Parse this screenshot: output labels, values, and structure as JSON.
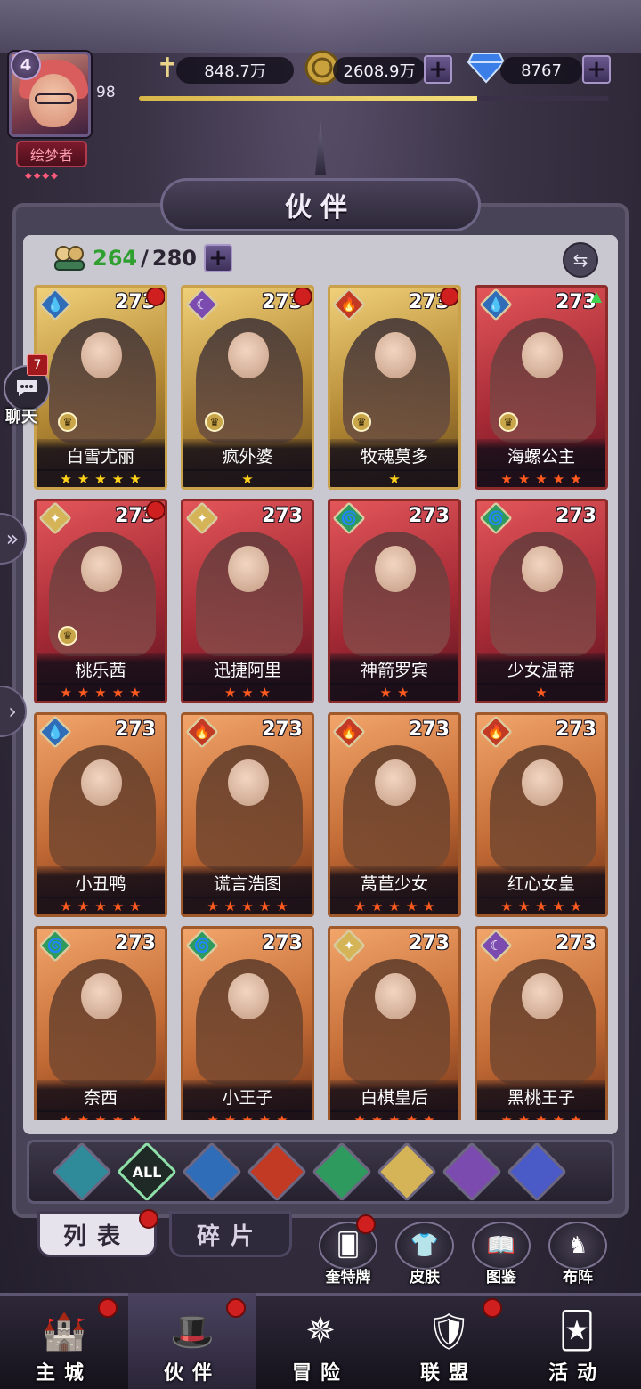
{
  "player": {
    "level": "4",
    "vip_value": "98",
    "title": "绘梦者",
    "title_stars": "◆◆◆◆"
  },
  "resources": {
    "power": "848.7万",
    "gold": "2608.9万",
    "diamonds": "8767",
    "plus": "+",
    "exp_progress": 0.72
  },
  "panel": {
    "title": "伙伴",
    "owned": "264",
    "separator": "/",
    "capacity": "280",
    "plus": "+",
    "sort_glyph": "⇆"
  },
  "chat": {
    "badge": "7",
    "label": "聊天"
  },
  "edge_arrows": {
    "double": "»",
    "single": "›"
  },
  "heroes": [
    {
      "name": "白雪尤丽",
      "level": "273",
      "element": "water",
      "stars": 5,
      "star_color": "yellow",
      "frame": "gold",
      "red_dot": true,
      "crown": true,
      "upgrade": false
    },
    {
      "name": "疯外婆",
      "level": "273",
      "element": "dark",
      "stars": 1,
      "star_color": "yellow",
      "frame": "gold",
      "red_dot": true,
      "crown": true,
      "upgrade": false
    },
    {
      "name": "牧魂莫多",
      "level": "273",
      "element": "fire",
      "stars": 1,
      "star_color": "yellow",
      "frame": "gold",
      "red_dot": true,
      "crown": true,
      "upgrade": false
    },
    {
      "name": "海螺公主",
      "level": "273",
      "element": "water",
      "stars": 5,
      "star_color": "orange",
      "frame": "red",
      "red_dot": false,
      "crown": true,
      "upgrade": true
    },
    {
      "name": "桃乐茜",
      "level": "273",
      "element": "light",
      "stars": 5,
      "star_color": "orange",
      "frame": "red",
      "red_dot": true,
      "crown": true,
      "upgrade": false
    },
    {
      "name": "迅捷阿里",
      "level": "273",
      "element": "light",
      "stars": 3,
      "star_color": "orange",
      "frame": "red",
      "red_dot": false,
      "crown": false,
      "upgrade": false
    },
    {
      "name": "神箭罗宾",
      "level": "273",
      "element": "wind",
      "stars": 2,
      "star_color": "orange",
      "frame": "red",
      "red_dot": false,
      "crown": false,
      "upgrade": false
    },
    {
      "name": "少女温蒂",
      "level": "273",
      "element": "wind",
      "stars": 1,
      "star_color": "orange",
      "frame": "red",
      "red_dot": false,
      "crown": false,
      "upgrade": false
    },
    {
      "name": "小丑鸭",
      "level": "273",
      "element": "water",
      "stars": 5,
      "star_color": "orange",
      "frame": "orange",
      "red_dot": false,
      "crown": false,
      "upgrade": false
    },
    {
      "name": "谎言浩图",
      "level": "273",
      "element": "fire",
      "stars": 5,
      "star_color": "orange",
      "frame": "orange",
      "red_dot": false,
      "crown": false,
      "upgrade": false
    },
    {
      "name": "莴苣少女",
      "level": "273",
      "element": "fire",
      "stars": 5,
      "star_color": "orange",
      "frame": "orange",
      "red_dot": false,
      "crown": false,
      "upgrade": false
    },
    {
      "name": "红心女皇",
      "level": "273",
      "element": "fire",
      "stars": 5,
      "star_color": "orange",
      "frame": "orange",
      "red_dot": false,
      "crown": false,
      "upgrade": false
    },
    {
      "name": "奈西",
      "level": "273",
      "element": "wind",
      "stars": 5,
      "star_color": "orange",
      "frame": "orange",
      "red_dot": false,
      "crown": false,
      "upgrade": false
    },
    {
      "name": "小王子",
      "level": "273",
      "element": "wind",
      "stars": 5,
      "star_color": "orange",
      "frame": "orange",
      "red_dot": false,
      "crown": false,
      "upgrade": false
    },
    {
      "name": "白棋皇后",
      "level": "273",
      "element": "light",
      "stars": 5,
      "star_color": "orange",
      "frame": "orange",
      "red_dot": false,
      "crown": false,
      "upgrade": false
    },
    {
      "name": "黑桃王子",
      "level": "273",
      "element": "dark",
      "stars": 5,
      "star_color": "orange",
      "frame": "orange",
      "red_dot": false,
      "crown": false,
      "upgrade": false
    }
  ],
  "filters": [
    {
      "id": "water-alt",
      "label": "",
      "color": "#2f8a9a",
      "selected": false
    },
    {
      "id": "all",
      "label": "ALL",
      "color": "#1f2a26",
      "selected": true
    },
    {
      "id": "water",
      "label": "",
      "color": "#2f6db8",
      "selected": false
    },
    {
      "id": "fire",
      "label": "",
      "color": "#c23a24",
      "selected": false
    },
    {
      "id": "wind",
      "label": "",
      "color": "#2f9a5d",
      "selected": false
    },
    {
      "id": "light",
      "label": "",
      "color": "#d4b456",
      "selected": false
    },
    {
      "id": "dark",
      "label": "",
      "color": "#7b4bb0",
      "selected": false
    },
    {
      "id": "cosmic",
      "label": "",
      "color": "#4a5bc8",
      "selected": false
    }
  ],
  "tabs": {
    "list": "列表",
    "shards": "碎片"
  },
  "side_buttons": [
    {
      "id": "tarot",
      "label": "奎特牌",
      "icon": "tarot-card-icon",
      "red_dot": true
    },
    {
      "id": "skin",
      "label": "皮肤",
      "icon": "skin-icon",
      "red_dot": false
    },
    {
      "id": "codex",
      "label": "图鉴",
      "icon": "codex-icon",
      "red_dot": false
    },
    {
      "id": "formation",
      "label": "布阵",
      "icon": "chess-icon",
      "red_dot": false
    }
  ],
  "nav": [
    {
      "id": "city",
      "label": "主城",
      "icon": "castle-icon",
      "red_dot": true,
      "active": false
    },
    {
      "id": "partners",
      "label": "伙伴",
      "icon": "witch-hat-icon",
      "red_dot": true,
      "active": true
    },
    {
      "id": "adventure",
      "label": "冒险",
      "icon": "compass-icon",
      "red_dot": false,
      "active": false
    },
    {
      "id": "alliance",
      "label": "联盟",
      "icon": "shield-icon",
      "red_dot": true,
      "active": false
    },
    {
      "id": "events",
      "label": "活动",
      "icon": "cards-icon",
      "red_dot": false,
      "active": false
    }
  ],
  "colors": {
    "accent_purple": "#6a5a8f",
    "owned_green": "#2fa02f",
    "notify_red": "#d01f1f",
    "star_yellow": "#ffd21a",
    "star_orange": "#ff5a1f"
  }
}
